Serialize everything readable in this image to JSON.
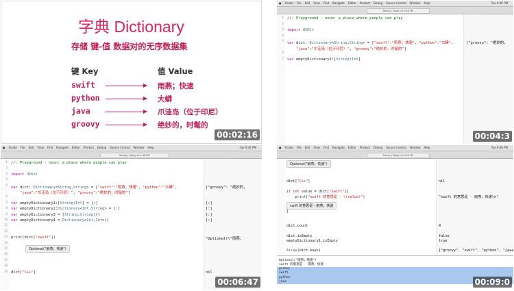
{
  "slide": {
    "title": "字典 Dictionary",
    "subtitle": "存储 键-值 数据对的无序数据集",
    "key_header": "键 Key",
    "value_header": "值 Value",
    "pairs": [
      {
        "key": "swift",
        "value": "雨燕；快速"
      },
      {
        "key": "python",
        "value": "大蟒"
      },
      {
        "key": "java",
        "value": "爪洼岛（位于印尼）"
      },
      {
        "key": "groovy",
        "value": "绝妙的，时髦的"
      }
    ],
    "timestamp": "00:02:16"
  },
  "menubar": {
    "items": [
      "Xcode",
      "File",
      "Edit",
      "View",
      "Find",
      "Navigate",
      "Editor",
      "Product",
      "Debug",
      "Source Control",
      "Window",
      "Help"
    ],
    "clock": "Tue 9:46 PM"
  },
  "toolbar_title": "Ready | Today at 9:46 PM",
  "panel2": {
    "timestamp": "00:04:3",
    "lines": [
      {
        "n": "1",
        "code": "//: Playground - noun: a place where people can play",
        "cls": "cmt"
      },
      {
        "n": "2",
        "code": "",
        "cls": ""
      },
      {
        "n": "3",
        "code": "import UIKit",
        "cls": ""
      },
      {
        "n": "4",
        "code": "",
        "cls": ""
      },
      {
        "n": "5",
        "code": "var dict: Dictionary<String,String> = [\"swift\":\"雨燕；快速\", \"python\":\"大蟒\",",
        "cls": ""
      },
      {
        "n": "",
        "code": "    \"java\":\"爪洼岛（位于印尼）\", \"groovy\":\"绝妙的，时髦的\"]",
        "cls": ""
      },
      {
        "n": "6",
        "code": "",
        "cls": ""
      },
      {
        "n": "7",
        "code": "var emptyDictionary1:[String:Int]",
        "cls": ""
      }
    ],
    "results": [
      {
        "text": "[\"groovy\": \"绝妙的，",
        "row": 4
      }
    ]
  },
  "panel3": {
    "timestamp": "00:06:47",
    "lines": [
      {
        "n": "1",
        "code": "//: Playground - noun: a place where people can play",
        "cls": "cmt"
      },
      {
        "n": "2",
        "code": "",
        "cls": ""
      },
      {
        "n": "3",
        "code": "import UIKit",
        "cls": ""
      },
      {
        "n": "4",
        "code": "",
        "cls": ""
      },
      {
        "n": "5",
        "code": "var dict: Dictionary<String,String> = [\"swift\":\"雨燕；快速\", \"python\":\"大蟒\",",
        "cls": ""
      },
      {
        "n": "",
        "code": "    \"java\":\"爪洼岛（位于印尼）\", \"groovy\":\"绝妙的，时髦的\"]",
        "cls": ""
      },
      {
        "n": "6",
        "code": "",
        "cls": ""
      },
      {
        "n": "7",
        "code": "var emptyDictionary1:[String:Int] = [:]",
        "cls": ""
      },
      {
        "n": "8",
        "code": "var emptyDictionary2:Dictionary<Int,String> = [:]",
        "cls": ""
      },
      {
        "n": "9",
        "code": "var emptyDictionary3 = [String:String]()",
        "cls": ""
      },
      {
        "n": "10",
        "code": "var emptyDictionary4 = Dictionary<Int,Int>()",
        "cls": ""
      },
      {
        "n": "11",
        "code": "",
        "cls": ""
      },
      {
        "n": "12",
        "code": "",
        "cls": ""
      },
      {
        "n": "13",
        "code": "print(dict[\"swift\"])",
        "cls": ""
      },
      {
        "n": "14",
        "code": "",
        "cls": ""
      },
      {
        "n": "15",
        "code": "",
        "cls": ""
      },
      {
        "n": "16",
        "code": "",
        "cls": ""
      },
      {
        "n": "17",
        "code": "",
        "cls": ""
      },
      {
        "n": "18",
        "code": "",
        "cls": ""
      },
      {
        "n": "19",
        "code": "dict[\"C++\"]",
        "cls": ""
      }
    ],
    "results": [
      {
        "text": "[\"groovy\": \"绝妙的，",
        "row": 4
      },
      {
        "text": "[:]",
        "row": 7
      },
      {
        "text": "[:]",
        "row": 8
      },
      {
        "text": "[:]",
        "row": 9
      },
      {
        "text": "[:]",
        "row": 10
      },
      {
        "text": "\"Optional(\\\"雨燕；",
        "row": 13
      },
      {
        "text": "nil",
        "row": 19
      }
    ],
    "popup": "Optional(\"雨燕；快速\")"
  },
  "panel4": {
    "timestamp": "00:09:0",
    "popup_top": "Optional(\"雨燕；快速\")",
    "lines": [
      {
        "n": "",
        "code": "",
        "cls": ""
      },
      {
        "n": "",
        "code": "",
        "cls": ""
      },
      {
        "n": "",
        "code": "dict[\"C++\"]",
        "cls": ""
      },
      {
        "n": "",
        "code": "",
        "cls": ""
      },
      {
        "n": "",
        "code": "if let value = dict[\"swift\"]{",
        "cls": ""
      },
      {
        "n": "",
        "code": "    print(\"swift 的意思是 - \\(value)\")",
        "cls": ""
      },
      {
        "n": "",
        "code": "",
        "cls": ""
      },
      {
        "n": "",
        "code": "",
        "cls": ""
      },
      {
        "n": "",
        "code": "}",
        "cls": ""
      },
      {
        "n": "",
        "code": "",
        "cls": ""
      },
      {
        "n": "",
        "code": "",
        "cls": ""
      },
      {
        "n": "",
        "code": "dict.count",
        "cls": ""
      },
      {
        "n": "",
        "code": "",
        "cls": ""
      },
      {
        "n": "",
        "code": "dict.isEmpty",
        "cls": ""
      },
      {
        "n": "",
        "code": "emptyDictionary1.isEmpty",
        "cls": ""
      },
      {
        "n": "",
        "code": "",
        "cls": ""
      },
      {
        "n": "",
        "code": "Array(dict.keys)",
        "cls": ""
      }
    ],
    "results": [
      {
        "text": "nil",
        "row": 2
      },
      {
        "text": "\"swift 的意思是 - 雨燕；快速\\n\"",
        "row": 5
      },
      {
        "text": "4",
        "row": 11
      },
      {
        "text": "false",
        "row": 13
      },
      {
        "text": "true",
        "row": 14
      },
      {
        "text": "[\"groovy\", \"swift\", \"python\", \"java\"]",
        "row": 16
      }
    ],
    "popup_mid": "swift 的意思是 - 雨燕；快速",
    "console": [
      "Optional(\"雨燕；快速\")",
      "swift 的意思是 - 雨燕；快速",
      "groovy",
      "swift",
      "python",
      "java"
    ]
  }
}
